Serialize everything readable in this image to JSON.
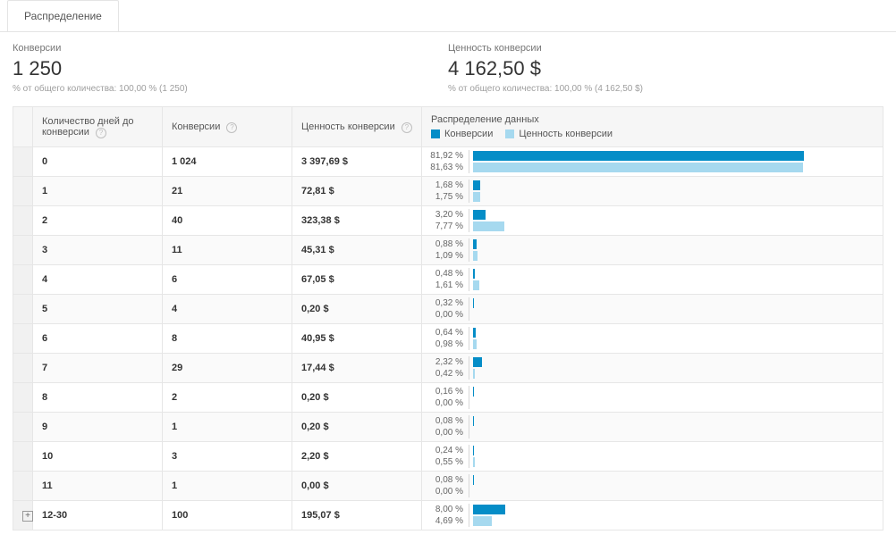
{
  "tabs": {
    "active": "Распределение"
  },
  "summary": {
    "left": {
      "label": "Конверсии",
      "value": "1 250",
      "note": "% от общего количества: 100,00 % (1 250)"
    },
    "right": {
      "label": "Ценность конверсии",
      "value": "4 162,50 $",
      "note": "% от общего количества: 100,00 % (4 162,50 $)"
    }
  },
  "headers": {
    "days": "Количество дней до конверсии",
    "conversions": "Конверсии",
    "value": "Ценность конверсии",
    "distribution": "Распределение данных"
  },
  "legend": {
    "conv": "Конверсии",
    "val": "Ценность конверсии"
  },
  "colors": {
    "conv": "#058dc7",
    "val": "#a6d9ef"
  },
  "chart_data": {
    "type": "bar",
    "title": "Распределение данных",
    "xlabel": "Количество дней до конверсии",
    "categories": [
      "0",
      "1",
      "2",
      "3",
      "4",
      "5",
      "6",
      "7",
      "8",
      "9",
      "10",
      "11",
      "12-30"
    ],
    "series": [
      {
        "name": "Конверсии",
        "unit": "%",
        "values": [
          81.92,
          1.68,
          3.2,
          0.88,
          0.48,
          0.32,
          0.64,
          2.32,
          0.16,
          0.08,
          0.24,
          0.08,
          8.0
        ]
      },
      {
        "name": "Ценность конверсии",
        "unit": "%",
        "values": [
          81.63,
          1.75,
          7.77,
          1.09,
          1.61,
          0.0,
          0.98,
          0.42,
          0.0,
          0.0,
          0.55,
          0.0,
          4.69
        ]
      }
    ],
    "ylim": [
      0,
      100
    ]
  },
  "rows": [
    {
      "days": "0",
      "conversions": "1 024",
      "value": "3 397,69 $",
      "pct_conv": "81,92 %",
      "pct_val": "81,63 %",
      "w_conv": 81.92,
      "w_val": 81.63,
      "expandable": false
    },
    {
      "days": "1",
      "conversions": "21",
      "value": "72,81 $",
      "pct_conv": "1,68 %",
      "pct_val": "1,75 %",
      "w_conv": 1.68,
      "w_val": 1.75,
      "expandable": false
    },
    {
      "days": "2",
      "conversions": "40",
      "value": "323,38 $",
      "pct_conv": "3,20 %",
      "pct_val": "7,77 %",
      "w_conv": 3.2,
      "w_val": 7.77,
      "expandable": false
    },
    {
      "days": "3",
      "conversions": "11",
      "value": "45,31 $",
      "pct_conv": "0,88 %",
      "pct_val": "1,09 %",
      "w_conv": 0.88,
      "w_val": 1.09,
      "expandable": false
    },
    {
      "days": "4",
      "conversions": "6",
      "value": "67,05 $",
      "pct_conv": "0,48 %",
      "pct_val": "1,61 %",
      "w_conv": 0.48,
      "w_val": 1.61,
      "expandable": false
    },
    {
      "days": "5",
      "conversions": "4",
      "value": "0,20 $",
      "pct_conv": "0,32 %",
      "pct_val": "0,00 %",
      "w_conv": 0.32,
      "w_val": 0.0,
      "expandable": false
    },
    {
      "days": "6",
      "conversions": "8",
      "value": "40,95 $",
      "pct_conv": "0,64 %",
      "pct_val": "0,98 %",
      "w_conv": 0.64,
      "w_val": 0.98,
      "expandable": false
    },
    {
      "days": "7",
      "conversions": "29",
      "value": "17,44 $",
      "pct_conv": "2,32 %",
      "pct_val": "0,42 %",
      "w_conv": 2.32,
      "w_val": 0.42,
      "expandable": false
    },
    {
      "days": "8",
      "conversions": "2",
      "value": "0,20 $",
      "pct_conv": "0,16 %",
      "pct_val": "0,00 %",
      "w_conv": 0.16,
      "w_val": 0.0,
      "expandable": false
    },
    {
      "days": "9",
      "conversions": "1",
      "value": "0,20 $",
      "pct_conv": "0,08 %",
      "pct_val": "0,00 %",
      "w_conv": 0.08,
      "w_val": 0.0,
      "expandable": false
    },
    {
      "days": "10",
      "conversions": "3",
      "value": "2,20 $",
      "pct_conv": "0,24 %",
      "pct_val": "0,55 %",
      "w_conv": 0.24,
      "w_val": 0.55,
      "expandable": false
    },
    {
      "days": "11",
      "conversions": "1",
      "value": "0,00 $",
      "pct_conv": "0,08 %",
      "pct_val": "0,00 %",
      "w_conv": 0.08,
      "w_val": 0.0,
      "expandable": false
    },
    {
      "days": "12-30",
      "conversions": "100",
      "value": "195,07 $",
      "pct_conv": "8,00 %",
      "pct_val": "4,69 %",
      "w_conv": 8.0,
      "w_val": 4.69,
      "expandable": true
    }
  ]
}
